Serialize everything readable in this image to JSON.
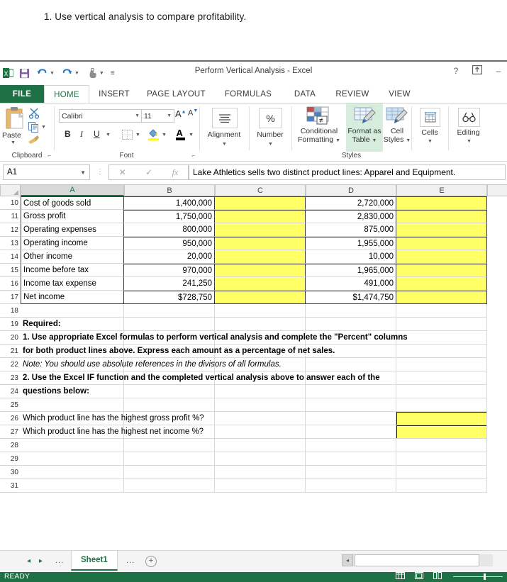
{
  "document": {
    "instruction": "1. Use vertical analysis to compare profitability."
  },
  "window": {
    "title": "Perform Vertical Analysis - Excel",
    "help_icon": "?",
    "ribbon_display_icon": "ribbon-options-icon",
    "minimize_icon": "–",
    "quick_access": [
      {
        "name": "excel-logo-icon",
        "glyph": "X"
      },
      {
        "name": "save-icon",
        "glyph": "💾"
      },
      {
        "name": "undo-icon",
        "glyph": "↶"
      },
      {
        "name": "redo-icon",
        "glyph": "↷"
      },
      {
        "name": "touch-mode-icon",
        "glyph": "☝"
      },
      {
        "name": "customize-qat-icon",
        "glyph": "≡"
      }
    ]
  },
  "ribbon": {
    "tabs": [
      {
        "label": "FILE",
        "active": false
      },
      {
        "label": "HOME",
        "active": true
      },
      {
        "label": "INSERT",
        "active": false
      },
      {
        "label": "PAGE LAYOUT",
        "active": false
      },
      {
        "label": "FORMULAS",
        "active": false
      },
      {
        "label": "DATA",
        "active": false
      },
      {
        "label": "REVIEW",
        "active": false
      },
      {
        "label": "VIEW",
        "active": false
      }
    ],
    "groups": {
      "clipboard": {
        "label": "Clipboard",
        "paste_label": "Paste",
        "cut_icon": "scissors-icon",
        "copy_icon": "copy-icon",
        "format_painter_icon": "format-painter-icon"
      },
      "font": {
        "label": "Font",
        "font_name": "Calibri",
        "font_size": "11",
        "grow_font": "A",
        "shrink_font": "A",
        "bold": "B",
        "italic": "I",
        "underline": "U",
        "borders_icon": "borders-icon",
        "fill_color_icon": "fill-color-icon",
        "font_color_icon": "font-color-icon"
      },
      "alignment": {
        "label": "Alignment",
        "icon": "align-icon"
      },
      "number": {
        "label": "Number",
        "icon": "percent-icon",
        "glyph": "%"
      },
      "styles": {
        "label": "Styles",
        "conditional_formatting": "Conditional Formatting",
        "format_as_table": "Format as Table",
        "cell_styles": "Cell Styles"
      },
      "cells": {
        "label": "Cells"
      },
      "editing": {
        "label": "Editing"
      }
    }
  },
  "formula_bar": {
    "name_box": "A1",
    "cancel_icon": "✕",
    "enter_icon": "✓",
    "function_icon": "fx",
    "content": "Lake Athletics sells two distinct product lines:  Apparel and Equipment."
  },
  "grid": {
    "columns": [
      "A",
      "B",
      "C",
      "D",
      "E"
    ],
    "selected_column": "A",
    "rows": [
      {
        "n": "10",
        "a": "Cost of goods sold",
        "b": "1,400,000",
        "c": "",
        "d": "2,720,000",
        "e": ""
      },
      {
        "n": "11",
        "a": "Gross profit",
        "b": "1,750,000",
        "c": "",
        "d": "2,830,000",
        "e": ""
      },
      {
        "n": "12",
        "a": "Operating expenses",
        "b": "800,000",
        "c": "",
        "d": "875,000",
        "e": ""
      },
      {
        "n": "13",
        "a": "Operating income",
        "b": "950,000",
        "c": "",
        "d": "1,955,000",
        "e": ""
      },
      {
        "n": "14",
        "a": "Other income",
        "b": "20,000",
        "c": "",
        "d": "10,000",
        "e": ""
      },
      {
        "n": "15",
        "a": "Income before tax",
        "b": "970,000",
        "c": "",
        "d": "1,965,000",
        "e": ""
      },
      {
        "n": "16",
        "a": "Income tax expense",
        "b": "241,250",
        "c": "",
        "d": "491,000",
        "e": ""
      },
      {
        "n": "17",
        "a": "Net income",
        "b": "$728,750",
        "c": "",
        "d": "$1,474,750",
        "e": ""
      },
      {
        "n": "18",
        "a": "",
        "b": "",
        "c": "",
        "d": "",
        "e": ""
      },
      {
        "n": "19",
        "a": "Required:",
        "b": "",
        "c": "",
        "d": "",
        "e": ""
      },
      {
        "n": "20",
        "a": "1. Use appropriate Excel formulas to perform vertical analysis and complete the \"Percent\" columns",
        "b": "",
        "c": "",
        "d": "",
        "e": ""
      },
      {
        "n": "21",
        "a": "    for both product lines above.  Express each amount as a percentage of net sales.",
        "b": "",
        "c": "",
        "d": "",
        "e": ""
      },
      {
        "n": "22",
        "a": "Note:  You should use absolute references in the divisors of all formulas.",
        "b": "",
        "c": "",
        "d": "",
        "e": ""
      },
      {
        "n": "23",
        "a": "2.  Use the Excel IF function and the completed vertical analysis above to answer each of the",
        "b": "",
        "c": "",
        "d": "",
        "e": ""
      },
      {
        "n": "24",
        "a": "    questions below:",
        "b": "",
        "c": "",
        "d": "",
        "e": ""
      },
      {
        "n": "25",
        "a": "",
        "b": "",
        "c": "",
        "d": "",
        "e": ""
      },
      {
        "n": "26",
        "a": "    Which product line has the highest gross profit %?",
        "b": "",
        "c": "",
        "d": "",
        "e": ""
      },
      {
        "n": "27",
        "a": "    Which product line has the highest net income %?",
        "b": "",
        "c": "",
        "d": "",
        "e": ""
      },
      {
        "n": "28",
        "a": "",
        "b": "",
        "c": "",
        "d": "",
        "e": ""
      },
      {
        "n": "29",
        "a": "",
        "b": "",
        "c": "",
        "d": "",
        "e": ""
      },
      {
        "n": "30",
        "a": "",
        "b": "",
        "c": "",
        "d": "",
        "e": ""
      },
      {
        "n": "31",
        "a": "",
        "b": "",
        "c": "",
        "d": "",
        "e": ""
      }
    ]
  },
  "sheet_bar": {
    "first_arrow": "◂",
    "next_arrow": "▸",
    "left_dots": "...",
    "right_dots": "...",
    "active_sheet": "Sheet1",
    "add_sheet": "+",
    "scroll_left_arrow": "◂"
  },
  "status_bar": {
    "text": "READY",
    "view_normal": "normal-view-icon",
    "view_page_layout": "page-layout-view-icon",
    "view_page_break": "page-break-view-icon"
  },
  "colors": {
    "excel_green": "#1e7145",
    "highlight_yellow": "#ffff66",
    "styles_highlight": "#d6ecdd"
  }
}
